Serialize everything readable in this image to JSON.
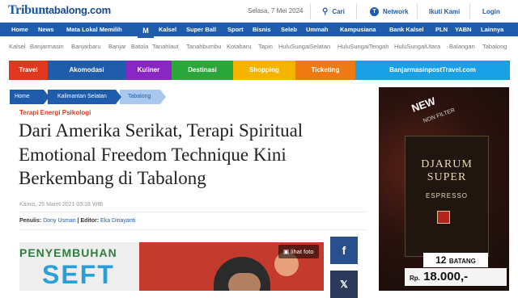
{
  "header": {
    "logo_main": "Tribun",
    "logo_sub": "tabalong.com",
    "date": "Selasa, 7 Mei 2024",
    "search_label": "Cari",
    "network_label": "Network",
    "follow_label": "Ikuti Kami",
    "login_label": "Login"
  },
  "nav": {
    "items": [
      "Home",
      "News",
      "Mata Lokal Memilih",
      "Kalsel",
      "Super Ball",
      "Sport",
      "Bisnis",
      "Seleb",
      "Ummah",
      "Kampusiana",
      "Bank Kalsel",
      "PLN",
      "YABN",
      "Lainnya"
    ]
  },
  "regions": [
    "Kalsel",
    "Banjarmasin",
    "Banjarbaru",
    "Banjar",
    "Batola",
    "Tanahlaut",
    "Tanahbumbu",
    "Kotabaru",
    "Tapin",
    "HuluSungaiSelatan",
    "HuluSungaiTengah",
    "HuluSungaiUtara",
    "Balangan",
    "Tabalong"
  ],
  "categories": [
    {
      "label": "Travel",
      "color": "#e0381f"
    },
    {
      "label": "Akomodasi",
      "color": "#1f5cab"
    },
    {
      "label": "Kuliner",
      "color": "#8a27c4"
    },
    {
      "label": "Destinasi",
      "color": "#2aa63a"
    },
    {
      "label": "Shopping",
      "color": "#f4b400"
    },
    {
      "label": "Ticketing",
      "color": "#f07a12"
    },
    {
      "label": "BanjarmasinpostTravel.com",
      "color": "#1aa0e6"
    }
  ],
  "breadcrumb": [
    "Home",
    "Kalimantan Selatan",
    "Tabalong"
  ],
  "article": {
    "kicker": "Terapi Energi Psikologi",
    "title": "Dari Amerika Serikat, Terapi Spiritual Emotional Freedom Technique Kini Berkembang di Tabalong",
    "date": "Kamis, 25 Maret 2021 09:18 WIB",
    "penulis_label": "Penulis:",
    "penulis": "Dony Usman",
    "editor_label": "| Editor:",
    "editor": "Eka Dinayanti",
    "photo_banner_1": "PENYEMBUHAN",
    "photo_banner_2": "SEFT",
    "photo_button": "lihat foto"
  },
  "share": {
    "facebook": "f",
    "x": "𝕏"
  },
  "ad": {
    "new_label": "NEW",
    "new_sub": "NON FILTER",
    "brand": "DJARUM SUPER",
    "variant": "ESPRESSO",
    "count": "12",
    "count_unit": "BATANG",
    "price_prefix": "Rp.",
    "price": "18.000,-"
  },
  "colors": {
    "brand_blue": "#1f5cab",
    "kicker_red": "#e0381f"
  }
}
